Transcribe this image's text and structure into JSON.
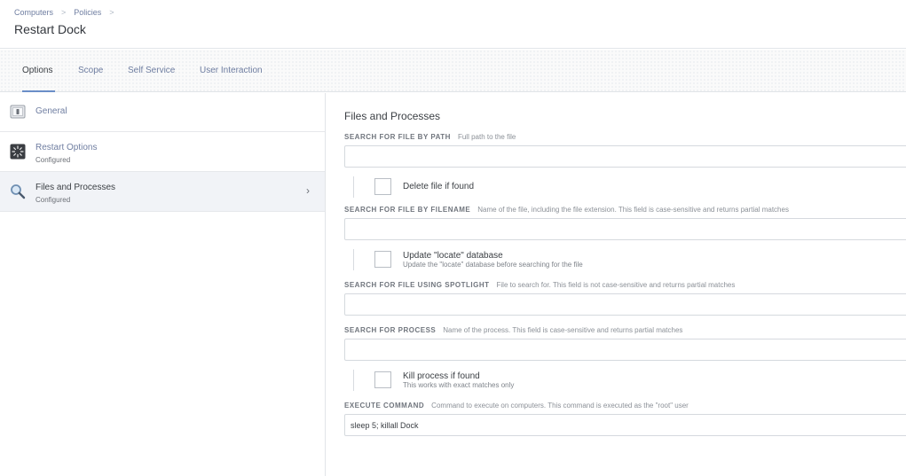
{
  "breadcrumb": {
    "items": [
      "Computers",
      "Policies"
    ],
    "separator": ">"
  },
  "page_title": "Restart Dock",
  "tabs": [
    {
      "label": "Options",
      "active": true
    },
    {
      "label": "Scope",
      "active": false
    },
    {
      "label": "Self Service",
      "active": false
    },
    {
      "label": "User Interaction",
      "active": false
    }
  ],
  "sidebar": {
    "items": [
      {
        "label": "General",
        "sub": "",
        "icon": "general-icon"
      },
      {
        "label": "Restart Options",
        "sub": "Configured",
        "icon": "restart-icon"
      },
      {
        "label": "Files and Processes",
        "sub": "Configured",
        "icon": "magnifier-icon",
        "selected": true
      }
    ],
    "chevron": "›"
  },
  "main": {
    "section_title": "Files and Processes",
    "file_path": {
      "label": "SEARCH FOR FILE BY PATH",
      "hint": "Full path to the file",
      "value": ""
    },
    "delete_file": {
      "label": "Delete file if found",
      "checked": false
    },
    "filename": {
      "label": "SEARCH FOR FILE BY FILENAME",
      "hint": "Name of the file, including the file extension. This field is case-sensitive and returns partial matches",
      "value": ""
    },
    "update_locate": {
      "label": "Update \"locate\" database",
      "sub": "Update the \"locate\" database before searching for the file",
      "checked": false
    },
    "spotlight": {
      "label": "SEARCH FOR FILE USING SPOTLIGHT",
      "hint": "File to search for. This field is not case-sensitive and returns partial matches",
      "value": ""
    },
    "process": {
      "label": "SEARCH FOR PROCESS",
      "hint": "Name of the process. This field is case-sensitive and returns partial matches",
      "value": ""
    },
    "kill_process": {
      "label": "Kill process if found",
      "sub": "This works with exact matches only",
      "checked": false
    },
    "execute": {
      "label": "EXECUTE COMMAND",
      "hint": "Command to execute on computers. This command is executed as the \"root\" user",
      "value": "sleep 5; killall Dock"
    }
  },
  "colors": {
    "link": "#6f7ea1",
    "accent": "#6a8ec8",
    "selected_bg": "#f1f3f7"
  }
}
